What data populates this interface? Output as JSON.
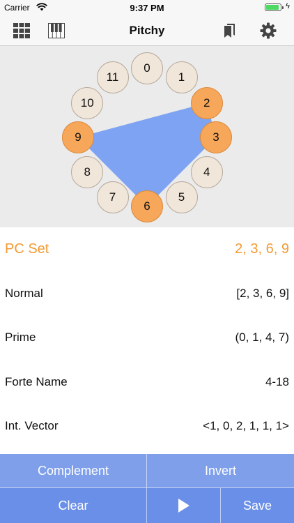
{
  "status_bar": {
    "carrier": "Carrier",
    "time": "9:37 PM"
  },
  "nav": {
    "title": "Pitchy",
    "left_icons": [
      "grid-icon",
      "piano-keys-icon"
    ],
    "right_icons": [
      "bookmarks-icon",
      "gear-icon"
    ]
  },
  "pitch_classes": [
    {
      "label": "0",
      "selected": false
    },
    {
      "label": "1",
      "selected": false
    },
    {
      "label": "2",
      "selected": true
    },
    {
      "label": "3",
      "selected": true
    },
    {
      "label": "4",
      "selected": false
    },
    {
      "label": "5",
      "selected": false
    },
    {
      "label": "6",
      "selected": true
    },
    {
      "label": "7",
      "selected": false
    },
    {
      "label": "8",
      "selected": false
    },
    {
      "label": "9",
      "selected": true
    },
    {
      "label": "10",
      "selected": false
    },
    {
      "label": "11",
      "selected": false
    }
  ],
  "colors": {
    "selected_node": "#f7a75a",
    "unselected_node": "#f1e6da",
    "polygon": "#7ea3f2",
    "accent_text": "#f29b33",
    "button_bar": "#6a8fe8"
  },
  "info": {
    "pc_set": {
      "label": "PC Set",
      "value": "2, 3, 6, 9"
    },
    "normal": {
      "label": "Normal",
      "value": "[2, 3, 6, 9]"
    },
    "prime": {
      "label": "Prime",
      "value": "(0, 1, 4, 7)"
    },
    "forte": {
      "label": "Forte Name",
      "value": "4-18"
    },
    "vector": {
      "label": "Int. Vector",
      "value": "<1, 0, 2, 1, 1, 1>"
    }
  },
  "buttons": {
    "complement": "Complement",
    "invert": "Invert",
    "clear": "Clear",
    "save": "Save"
  }
}
